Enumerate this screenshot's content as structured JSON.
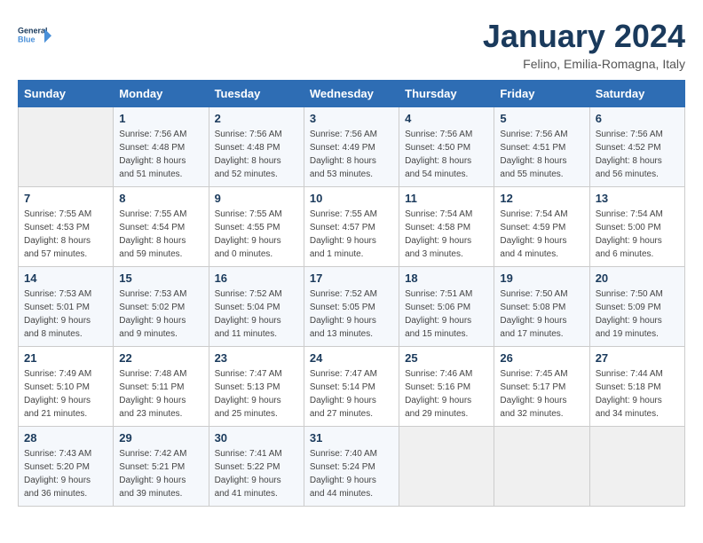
{
  "header": {
    "logo_line1": "General",
    "logo_line2": "Blue",
    "month": "January 2024",
    "location": "Felino, Emilia-Romagna, Italy"
  },
  "weekdays": [
    "Sunday",
    "Monday",
    "Tuesday",
    "Wednesday",
    "Thursday",
    "Friday",
    "Saturday"
  ],
  "weeks": [
    [
      {
        "day": "",
        "sunrise": "",
        "sunset": "",
        "daylight": ""
      },
      {
        "day": "1",
        "sunrise": "Sunrise: 7:56 AM",
        "sunset": "Sunset: 4:48 PM",
        "daylight": "Daylight: 8 hours and 51 minutes."
      },
      {
        "day": "2",
        "sunrise": "Sunrise: 7:56 AM",
        "sunset": "Sunset: 4:48 PM",
        "daylight": "Daylight: 8 hours and 52 minutes."
      },
      {
        "day": "3",
        "sunrise": "Sunrise: 7:56 AM",
        "sunset": "Sunset: 4:49 PM",
        "daylight": "Daylight: 8 hours and 53 minutes."
      },
      {
        "day": "4",
        "sunrise": "Sunrise: 7:56 AM",
        "sunset": "Sunset: 4:50 PM",
        "daylight": "Daylight: 8 hours and 54 minutes."
      },
      {
        "day": "5",
        "sunrise": "Sunrise: 7:56 AM",
        "sunset": "Sunset: 4:51 PM",
        "daylight": "Daylight: 8 hours and 55 minutes."
      },
      {
        "day": "6",
        "sunrise": "Sunrise: 7:56 AM",
        "sunset": "Sunset: 4:52 PM",
        "daylight": "Daylight: 8 hours and 56 minutes."
      }
    ],
    [
      {
        "day": "7",
        "sunrise": "Sunrise: 7:55 AM",
        "sunset": "Sunset: 4:53 PM",
        "daylight": "Daylight: 8 hours and 57 minutes."
      },
      {
        "day": "8",
        "sunrise": "Sunrise: 7:55 AM",
        "sunset": "Sunset: 4:54 PM",
        "daylight": "Daylight: 8 hours and 59 minutes."
      },
      {
        "day": "9",
        "sunrise": "Sunrise: 7:55 AM",
        "sunset": "Sunset: 4:55 PM",
        "daylight": "Daylight: 9 hours and 0 minutes."
      },
      {
        "day": "10",
        "sunrise": "Sunrise: 7:55 AM",
        "sunset": "Sunset: 4:57 PM",
        "daylight": "Daylight: 9 hours and 1 minute."
      },
      {
        "day": "11",
        "sunrise": "Sunrise: 7:54 AM",
        "sunset": "Sunset: 4:58 PM",
        "daylight": "Daylight: 9 hours and 3 minutes."
      },
      {
        "day": "12",
        "sunrise": "Sunrise: 7:54 AM",
        "sunset": "Sunset: 4:59 PM",
        "daylight": "Daylight: 9 hours and 4 minutes."
      },
      {
        "day": "13",
        "sunrise": "Sunrise: 7:54 AM",
        "sunset": "Sunset: 5:00 PM",
        "daylight": "Daylight: 9 hours and 6 minutes."
      }
    ],
    [
      {
        "day": "14",
        "sunrise": "Sunrise: 7:53 AM",
        "sunset": "Sunset: 5:01 PM",
        "daylight": "Daylight: 9 hours and 8 minutes."
      },
      {
        "day": "15",
        "sunrise": "Sunrise: 7:53 AM",
        "sunset": "Sunset: 5:02 PM",
        "daylight": "Daylight: 9 hours and 9 minutes."
      },
      {
        "day": "16",
        "sunrise": "Sunrise: 7:52 AM",
        "sunset": "Sunset: 5:04 PM",
        "daylight": "Daylight: 9 hours and 11 minutes."
      },
      {
        "day": "17",
        "sunrise": "Sunrise: 7:52 AM",
        "sunset": "Sunset: 5:05 PM",
        "daylight": "Daylight: 9 hours and 13 minutes."
      },
      {
        "day": "18",
        "sunrise": "Sunrise: 7:51 AM",
        "sunset": "Sunset: 5:06 PM",
        "daylight": "Daylight: 9 hours and 15 minutes."
      },
      {
        "day": "19",
        "sunrise": "Sunrise: 7:50 AM",
        "sunset": "Sunset: 5:08 PM",
        "daylight": "Daylight: 9 hours and 17 minutes."
      },
      {
        "day": "20",
        "sunrise": "Sunrise: 7:50 AM",
        "sunset": "Sunset: 5:09 PM",
        "daylight": "Daylight: 9 hours and 19 minutes."
      }
    ],
    [
      {
        "day": "21",
        "sunrise": "Sunrise: 7:49 AM",
        "sunset": "Sunset: 5:10 PM",
        "daylight": "Daylight: 9 hours and 21 minutes."
      },
      {
        "day": "22",
        "sunrise": "Sunrise: 7:48 AM",
        "sunset": "Sunset: 5:11 PM",
        "daylight": "Daylight: 9 hours and 23 minutes."
      },
      {
        "day": "23",
        "sunrise": "Sunrise: 7:47 AM",
        "sunset": "Sunset: 5:13 PM",
        "daylight": "Daylight: 9 hours and 25 minutes."
      },
      {
        "day": "24",
        "sunrise": "Sunrise: 7:47 AM",
        "sunset": "Sunset: 5:14 PM",
        "daylight": "Daylight: 9 hours and 27 minutes."
      },
      {
        "day": "25",
        "sunrise": "Sunrise: 7:46 AM",
        "sunset": "Sunset: 5:16 PM",
        "daylight": "Daylight: 9 hours and 29 minutes."
      },
      {
        "day": "26",
        "sunrise": "Sunrise: 7:45 AM",
        "sunset": "Sunset: 5:17 PM",
        "daylight": "Daylight: 9 hours and 32 minutes."
      },
      {
        "day": "27",
        "sunrise": "Sunrise: 7:44 AM",
        "sunset": "Sunset: 5:18 PM",
        "daylight": "Daylight: 9 hours and 34 minutes."
      }
    ],
    [
      {
        "day": "28",
        "sunrise": "Sunrise: 7:43 AM",
        "sunset": "Sunset: 5:20 PM",
        "daylight": "Daylight: 9 hours and 36 minutes."
      },
      {
        "day": "29",
        "sunrise": "Sunrise: 7:42 AM",
        "sunset": "Sunset: 5:21 PM",
        "daylight": "Daylight: 9 hours and 39 minutes."
      },
      {
        "day": "30",
        "sunrise": "Sunrise: 7:41 AM",
        "sunset": "Sunset: 5:22 PM",
        "daylight": "Daylight: 9 hours and 41 minutes."
      },
      {
        "day": "31",
        "sunrise": "Sunrise: 7:40 AM",
        "sunset": "Sunset: 5:24 PM",
        "daylight": "Daylight: 9 hours and 44 minutes."
      },
      {
        "day": "",
        "sunrise": "",
        "sunset": "",
        "daylight": ""
      },
      {
        "day": "",
        "sunrise": "",
        "sunset": "",
        "daylight": ""
      },
      {
        "day": "",
        "sunrise": "",
        "sunset": "",
        "daylight": ""
      }
    ]
  ]
}
